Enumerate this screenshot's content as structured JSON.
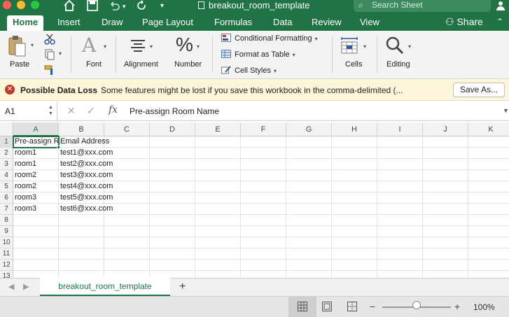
{
  "window": {
    "title": "breakout_room_template",
    "search_placeholder": "Search Sheet"
  },
  "menu": {
    "tabs": [
      "Home",
      "Insert",
      "Draw",
      "Page Layout",
      "Formulas",
      "Data",
      "Review",
      "View"
    ],
    "active_tab": "Home",
    "share_label": "Share"
  },
  "ribbon": {
    "paste": "Paste",
    "font": "Font",
    "alignment": "Alignment",
    "number": "Number",
    "conditional_formatting": "Conditional Formatting",
    "format_as_table": "Format as Table",
    "cell_styles": "Cell Styles",
    "cells": "Cells",
    "editing": "Editing"
  },
  "message_bar": {
    "title": "Possible Data Loss",
    "text": "Some features might be lost if you save this workbook in the comma-delimited (...",
    "button": "Save As..."
  },
  "formula_bar": {
    "name_box": "A1",
    "fx_label": "fx",
    "content": "Pre-assign Room Name"
  },
  "sheet": {
    "columns": [
      "A",
      "B",
      "C",
      "D",
      "E",
      "F",
      "G",
      "H",
      "I",
      "J",
      "K"
    ],
    "rows": [
      "1",
      "2",
      "3",
      "4",
      "5",
      "6",
      "7",
      "8",
      "9",
      "10",
      "11",
      "12",
      "13"
    ],
    "header_cells": [
      "Pre-assign Room Name",
      "Email Address"
    ],
    "data": [
      [
        "room1",
        "test1@xxx.com"
      ],
      [
        "room1",
        "test2@xxx.com"
      ],
      [
        "room2",
        "test3@xxx.com"
      ],
      [
        "room2",
        "test4@xxx.com"
      ],
      [
        "room3",
        "test5@xxx.com"
      ],
      [
        "room3",
        "test6@xxx.com"
      ]
    ],
    "active_cell": "A1"
  },
  "sheet_tabs": {
    "tabs": [
      "breakout_room_template"
    ],
    "add_label": "+"
  },
  "status_bar": {
    "zoom_label": "100%",
    "zoom_fraction": 0.5
  },
  "colors": {
    "brand_green": "#217346",
    "message_bg": "#fdf6db"
  }
}
